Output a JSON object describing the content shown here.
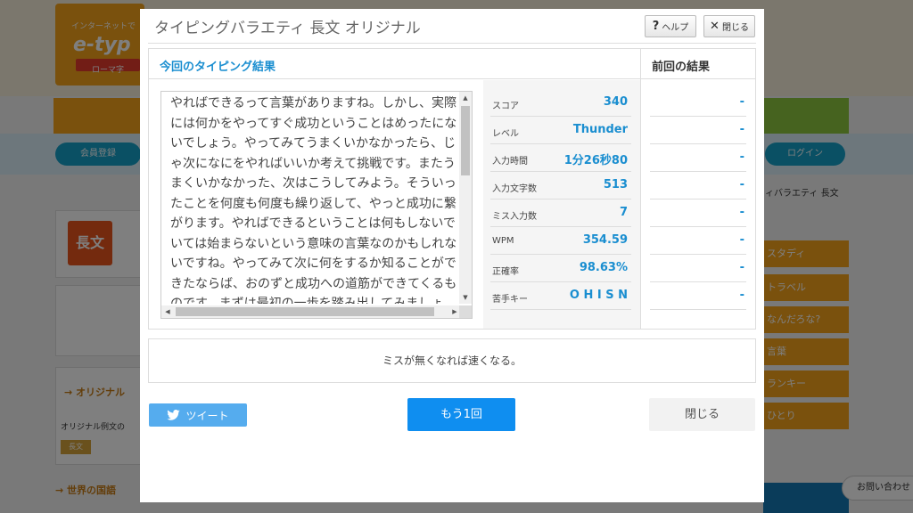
{
  "background": {
    "logo_tagline": "インターネットで",
    "logo_name": "e-typ",
    "logo_sub": "ローマ字",
    "member_button": "会員登録",
    "login_button": "ログイン",
    "breadcrumb": "ィバラエティ 長文",
    "left_card_icon": "長文",
    "original_section_title": "→ オリジナル",
    "original_text": "オリジナル例文の",
    "original_chip": "長文",
    "bottom_left_title": "→ 世界の国語",
    "right_menu": [
      "スタディ",
      "トラベル",
      "なんだろな?",
      "言葉",
      "ランキー",
      "ひとり"
    ],
    "inquiry_label": "お問い合わせ",
    "colors": {
      "orange": "#f4a21b",
      "blue": "#15a0c8"
    }
  },
  "modal": {
    "title": "タイピングバラエティ 長文 オリジナル",
    "help_button": "ヘルプ",
    "close_button": "閉じる",
    "current_result_heading": "今回のタイピング結果",
    "previous_result_heading": "前回の結果",
    "typed_text": "やればできるって言葉がありますね。しかし、実際には何かをやってすぐ成功ということはめったにないでしょう。やってみてうまくいかなかったら、じゃ次になにをやればいいか考えて挑戦です。またうまくいかなかった、次はこうしてみよう。そういったことを何度も何度も繰り返して、やっと成功に繋がります。やればできるということは何もしないでいては始まらないという意味の言葉なのかもしれないですね。やってみて次に何をするか知ることができたならば、おのずと成功への道筋ができてくるものです。まずは最初の一歩を踏み出してみましょう。",
    "stats": [
      {
        "label": "スコア",
        "value": "340",
        "previous": "-"
      },
      {
        "label": "レベル",
        "value": "Thunder",
        "previous": "-"
      },
      {
        "label": "入力時間",
        "value": "1分26秒80",
        "previous": "-"
      },
      {
        "label": "入力文字数",
        "value": "513",
        "previous": "-"
      },
      {
        "label": "ミス入力数",
        "value": "7",
        "previous": "-"
      },
      {
        "label": "WPM",
        "value": "354.59",
        "previous": "-"
      },
      {
        "label": "正確率",
        "value": "98.63%",
        "previous": "-"
      },
      {
        "label": "苦手キー",
        "value": "O H I S N",
        "previous": "-"
      }
    ],
    "advice": "ミスが無くなれば速くなる。",
    "tweet_button": "ツイート",
    "retry_button": "もう1回",
    "close_bottom_button": "閉じる",
    "colors": {
      "accent": "#1a8ed0",
      "retry": "#0f8ef0",
      "tweet": "#55acee"
    }
  }
}
